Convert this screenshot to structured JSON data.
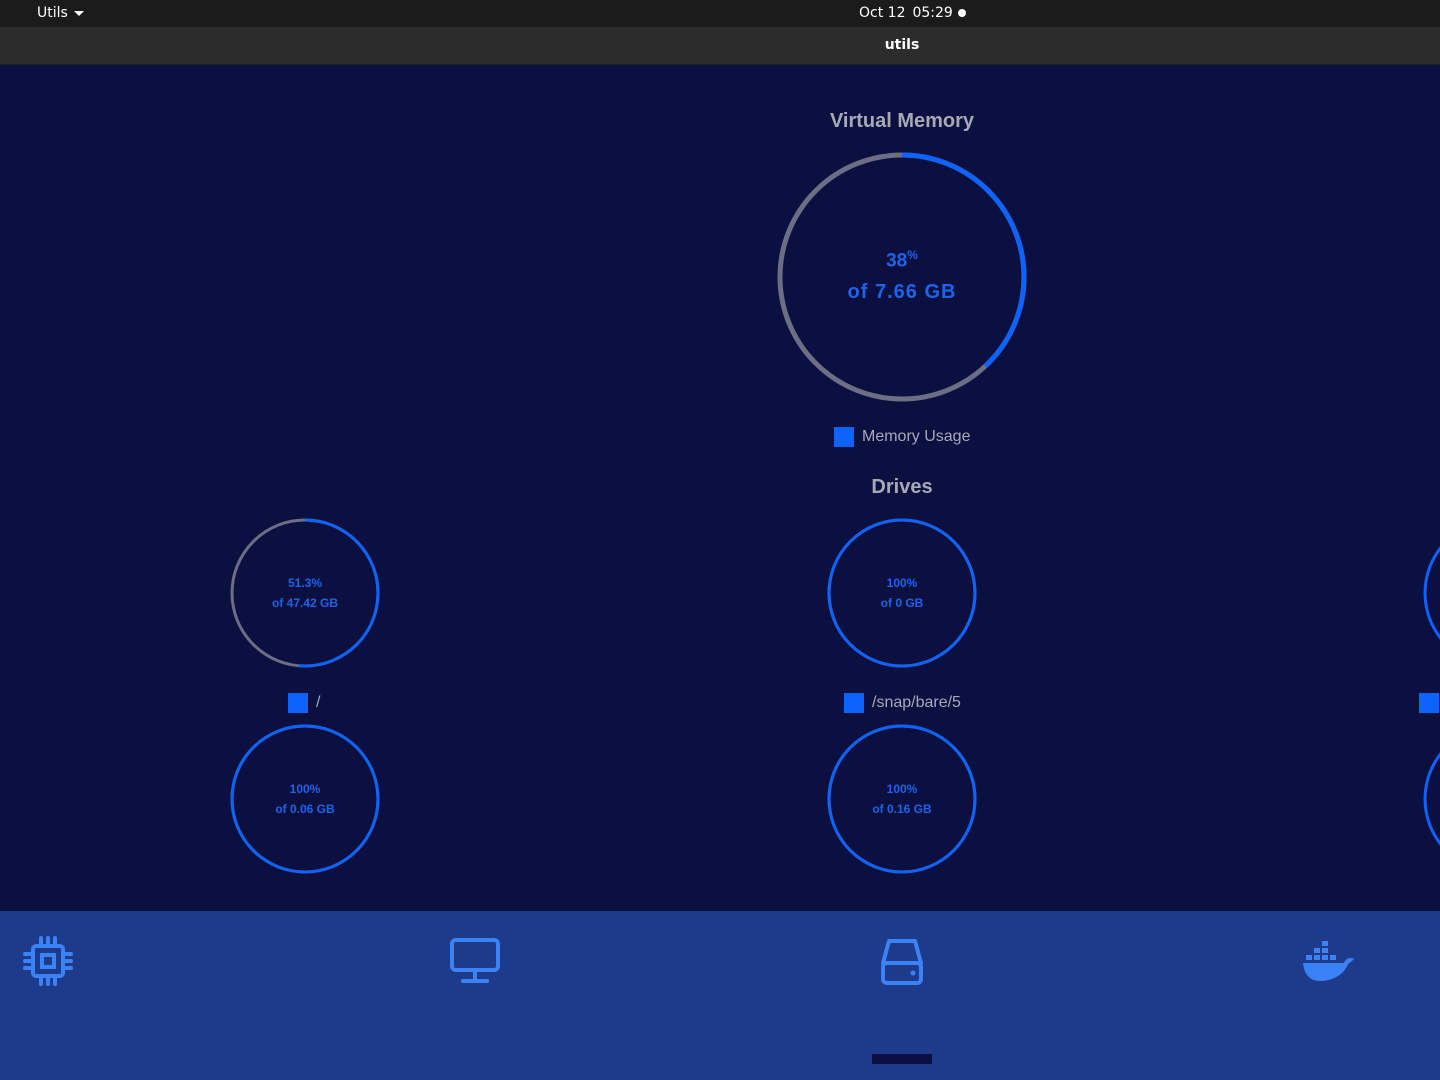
{
  "system_bar": {
    "app_menu_label": "Utils",
    "date": "Oct 12",
    "time": "05:29"
  },
  "window": {
    "title": "utils"
  },
  "virtual_memory": {
    "title": "Virtual Memory",
    "percent": "38",
    "percent_value": 38,
    "percent_sign": "%",
    "total_text": "of 7.66 GB",
    "legend_label": "Memory Usage"
  },
  "drives": {
    "title": "Drives",
    "items": [
      {
        "percent": "51.3",
        "percent_value": 51.3,
        "percent_sign": "%",
        "total_text": "of 47.42 GB",
        "legend_label": "/"
      },
      {
        "percent": "100",
        "percent_value": 100,
        "percent_sign": "%",
        "total_text": "of 0 GB",
        "legend_label": "/snap/bare/5"
      },
      {
        "percent": "100",
        "percent_value": 100,
        "percent_sign": "%",
        "total_text": "of 0.06 GB"
      },
      {
        "percent": "100",
        "percent_value": 100,
        "percent_sign": "%",
        "total_text": "of 0.16 GB"
      }
    ]
  },
  "nav": {
    "items": [
      {
        "icon": "cpu-icon"
      },
      {
        "icon": "monitor-icon"
      },
      {
        "icon": "hard-drive-icon",
        "active": true
      },
      {
        "icon": "docker-icon"
      }
    ]
  },
  "colors": {
    "background": "#0b1040",
    "accent": "#0d63fb",
    "track": "#6b6e85",
    "nav_background": "#1e3a8a",
    "label_text": "#a7a9b5"
  }
}
